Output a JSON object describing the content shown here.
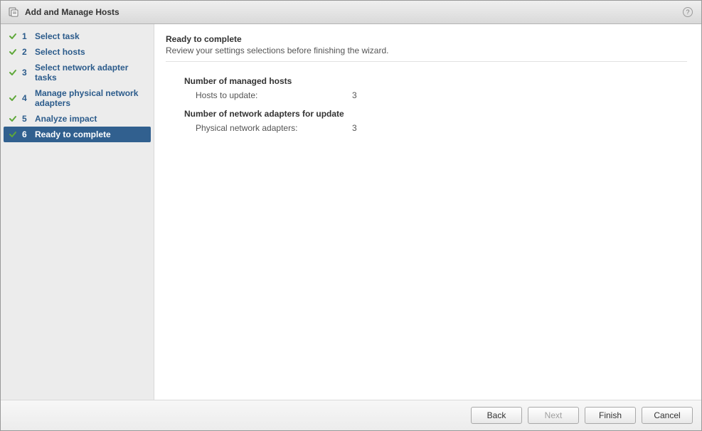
{
  "window": {
    "title": "Add and Manage Hosts"
  },
  "steps": [
    {
      "num": "1",
      "label": "Select task",
      "done": true,
      "active": false
    },
    {
      "num": "2",
      "label": "Select hosts",
      "done": true,
      "active": false
    },
    {
      "num": "3",
      "label": "Select network adapter tasks",
      "done": true,
      "active": false
    },
    {
      "num": "4",
      "label": "Manage physical network adapters",
      "done": true,
      "active": false
    },
    {
      "num": "5",
      "label": "Analyze impact",
      "done": true,
      "active": false
    },
    {
      "num": "6",
      "label": "Ready to complete",
      "done": true,
      "active": true
    }
  ],
  "main": {
    "heading": "Ready to complete",
    "subtitle": "Review your settings selections before finishing the wizard.",
    "groups": [
      {
        "title": "Number of managed hosts",
        "rows": [
          {
            "k": "Hosts to update:",
            "v": "3"
          }
        ]
      },
      {
        "title": "Number of network adapters for update",
        "rows": [
          {
            "k": "Physical network adapters:",
            "v": "3"
          }
        ]
      }
    ]
  },
  "footer": {
    "back": "Back",
    "next": "Next",
    "finish": "Finish",
    "cancel": "Cancel",
    "next_enabled": false
  }
}
